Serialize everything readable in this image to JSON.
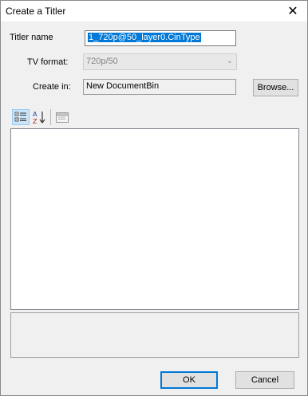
{
  "window": {
    "title": "Create a Titler",
    "close_glyph": "✕"
  },
  "form": {
    "titler_name_label": "Titler name",
    "titler_name_value": "1_720p@50_layer0.CinType",
    "tv_format_label": "TV format:",
    "tv_format_value": "720p/50",
    "create_in_label": "Create in:",
    "create_in_value": "New DocumentBin",
    "browse_label": "Browse..."
  },
  "toolbar": {
    "categorized_icon": "categorized-icon",
    "alphabetical_icon": "sort-alphabetical-icon",
    "property_pages_icon": "property-pages-icon"
  },
  "footer": {
    "ok_label": "OK",
    "cancel_label": "Cancel"
  },
  "colors": {
    "selection": "#0078d7",
    "window_bg": "#f0f0f0"
  }
}
